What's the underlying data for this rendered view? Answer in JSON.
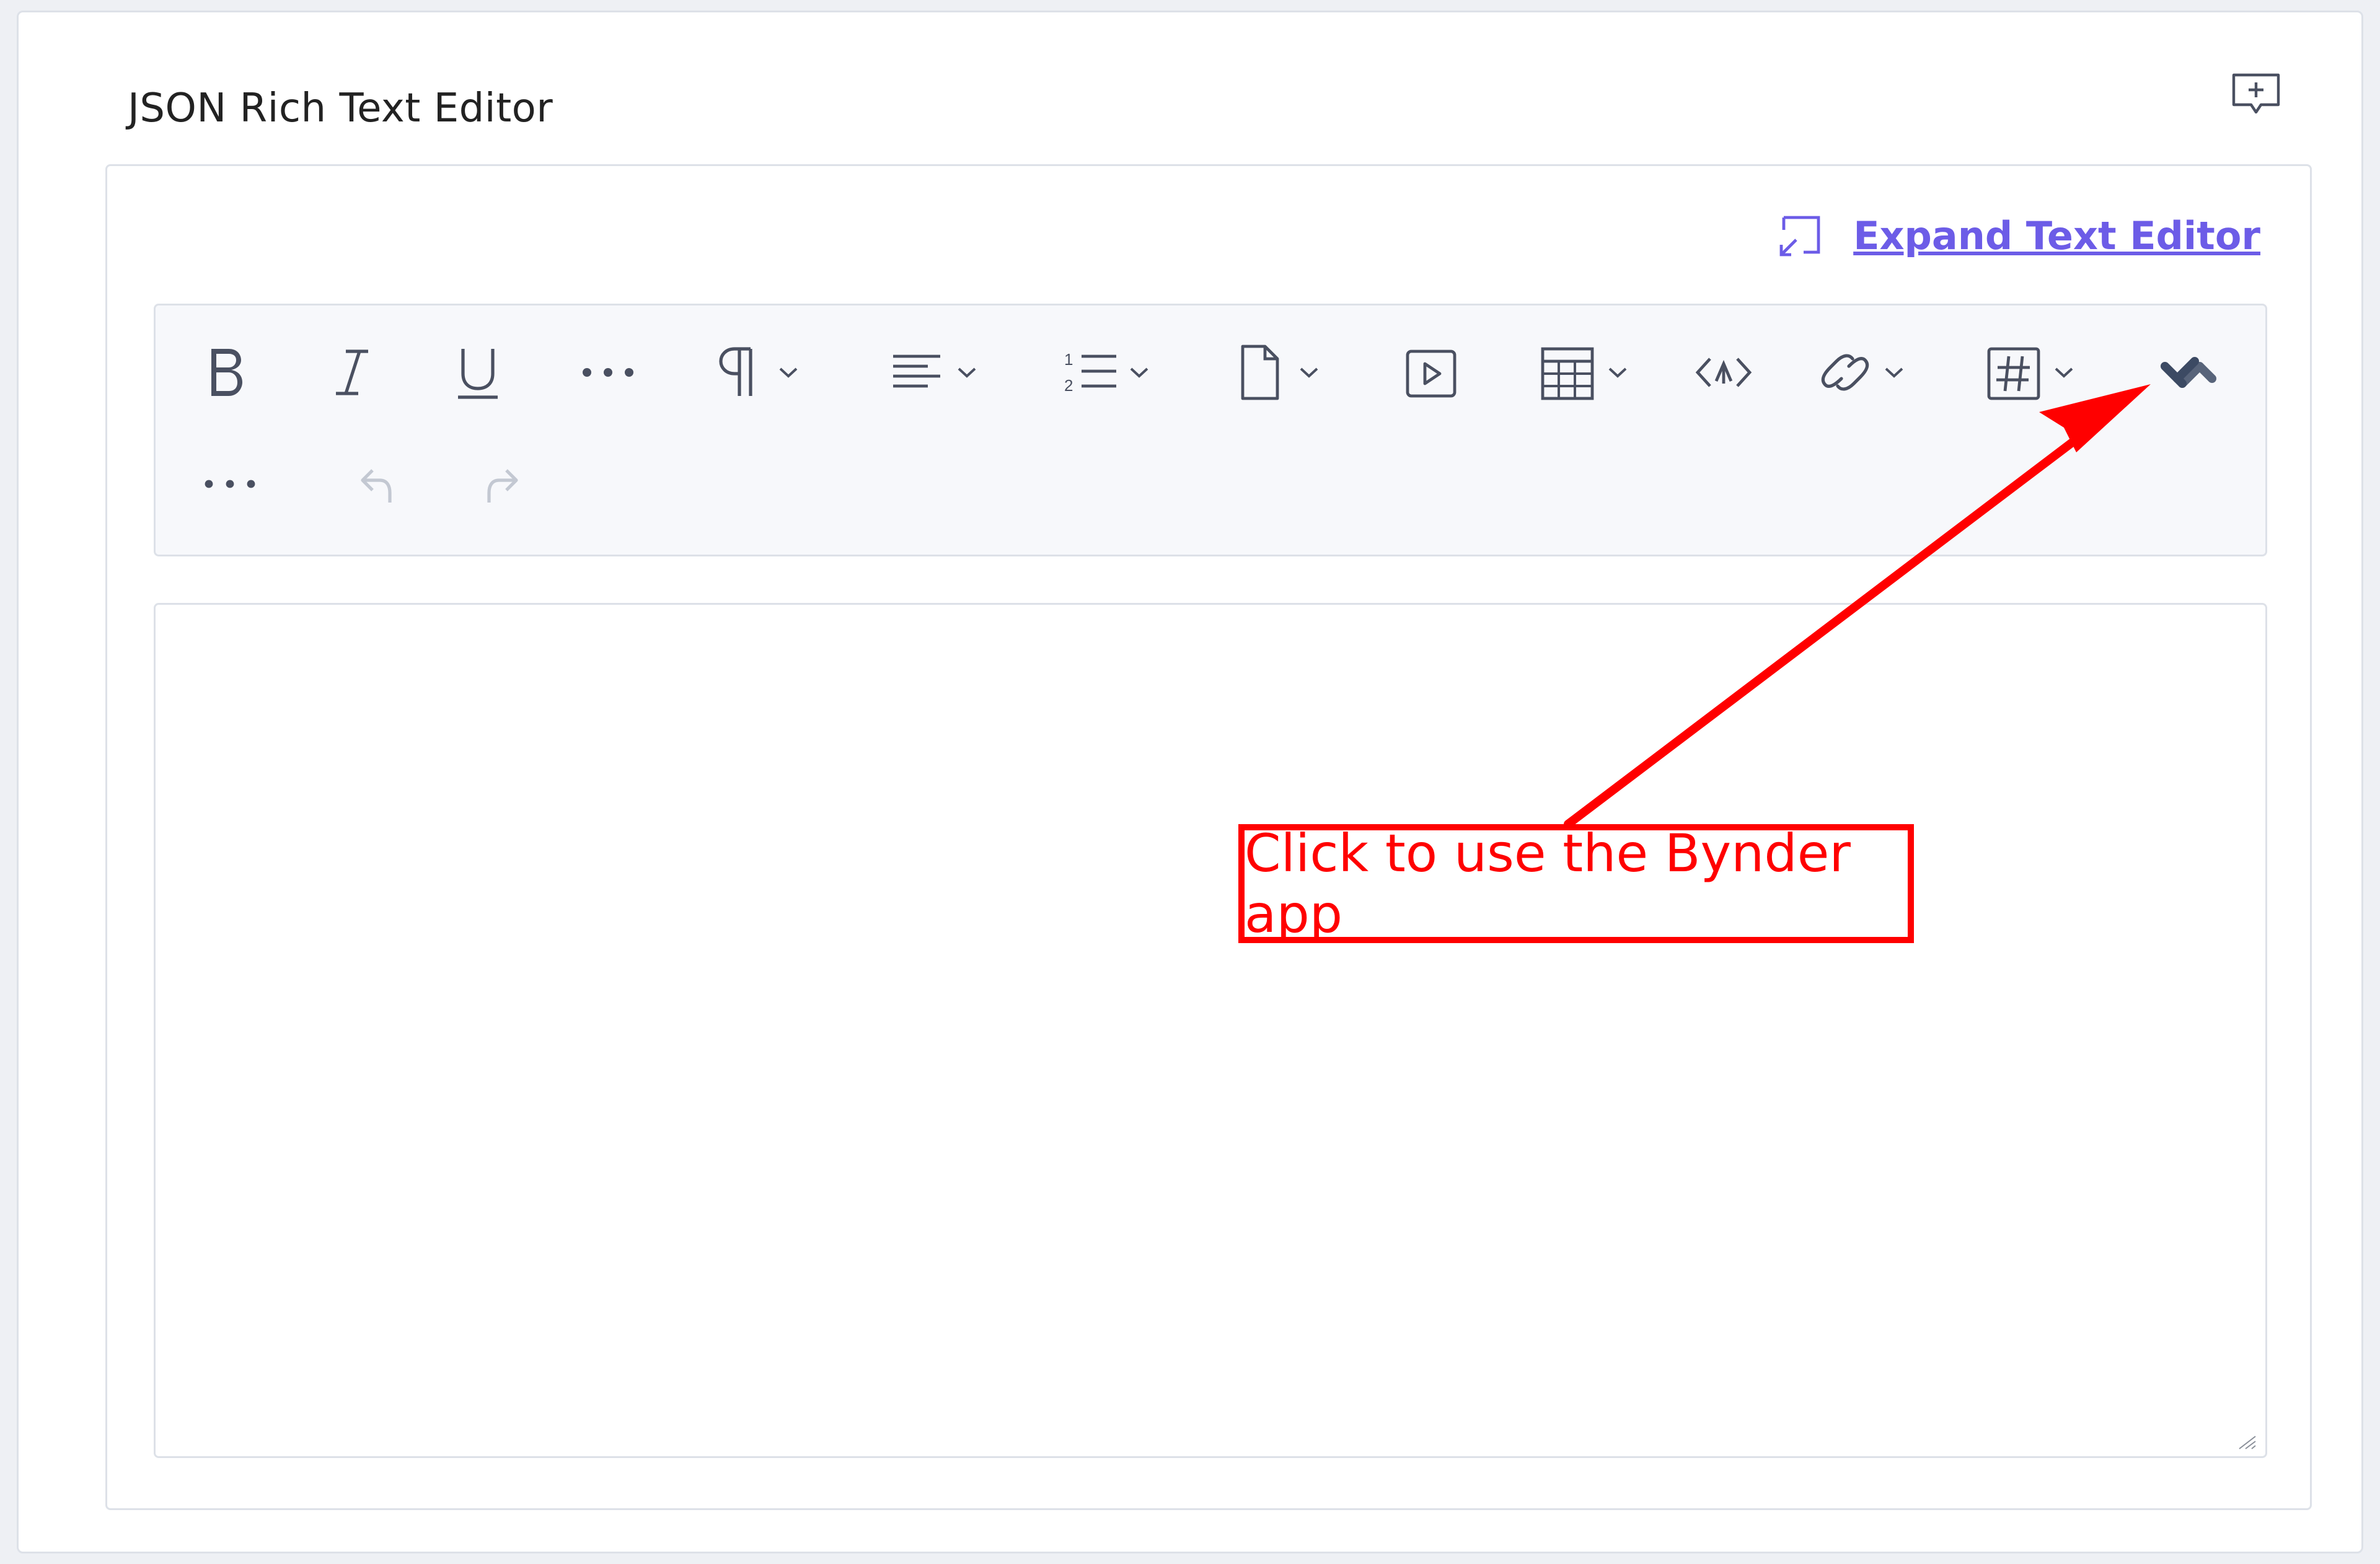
{
  "field": {
    "title": "JSON Rich Text Editor"
  },
  "editor": {
    "expand_label": "Expand Text Editor",
    "content": ""
  },
  "toolbar": {
    "buttons": [
      {
        "name": "bold",
        "icon": "bold-icon"
      },
      {
        "name": "italic",
        "icon": "italic-icon"
      },
      {
        "name": "underline",
        "icon": "underline-icon"
      },
      {
        "name": "more-formatting",
        "icon": "more-horizontal-icon"
      },
      {
        "name": "paragraph",
        "icon": "paragraph-icon",
        "dropdown": true
      },
      {
        "name": "align",
        "icon": "align-left-icon",
        "dropdown": true
      },
      {
        "name": "list",
        "icon": "ordered-list-icon",
        "dropdown": true
      },
      {
        "name": "asset",
        "icon": "file-icon",
        "dropdown": true
      },
      {
        "name": "embed-video",
        "icon": "play-video-icon"
      },
      {
        "name": "table",
        "icon": "table-icon",
        "dropdown": true
      },
      {
        "name": "code",
        "icon": "code-icon"
      },
      {
        "name": "link",
        "icon": "link-icon",
        "dropdown": true
      },
      {
        "name": "embed",
        "icon": "hash-box-icon",
        "dropdown": true
      },
      {
        "name": "bynder",
        "icon": "bynder-icon"
      },
      {
        "name": "more-tools",
        "icon": "more-horizontal-icon"
      },
      {
        "name": "undo",
        "icon": "undo-icon",
        "disabled": true
      },
      {
        "name": "redo",
        "icon": "redo-icon",
        "disabled": true
      }
    ]
  },
  "annotation": {
    "text": "Click to use the Bynder app",
    "color": "#ff0000"
  },
  "colors": {
    "link": "#6c5ce7",
    "icon": "#4a5061",
    "disabled_icon": "#c3c8d2",
    "bynder_icon": "#3c4a63",
    "border": "#dde1e8",
    "toolbar_bg": "#f7f8fb"
  }
}
